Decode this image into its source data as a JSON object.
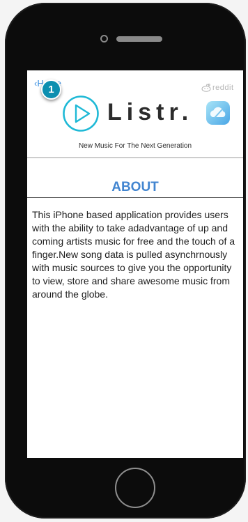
{
  "header": {
    "back_label": "Home",
    "badge_count": "1",
    "reddit_label": "reddit",
    "brand_name": "Listr.",
    "tagline": "New Music For The Next Generation"
  },
  "about": {
    "title": "ABOUT",
    "body": "This iPhone based application provides users with the ability to take adadvantage of up and coming artists music for free and the touch of a finger.New song data is pulled asynchrnously with music sources to give you the opportunity to view, store and share awesome music from around the globe."
  },
  "colors": {
    "accent_blue": "#4285d0",
    "logo_teal": "#1fb9d6",
    "badge_teal": "#0d8fb0",
    "phone_body": "#0c0c0c"
  },
  "icons": {
    "play": "play-circle-icon",
    "cloud": "cloud-app-icon",
    "reddit": "reddit-alien-icon"
  }
}
